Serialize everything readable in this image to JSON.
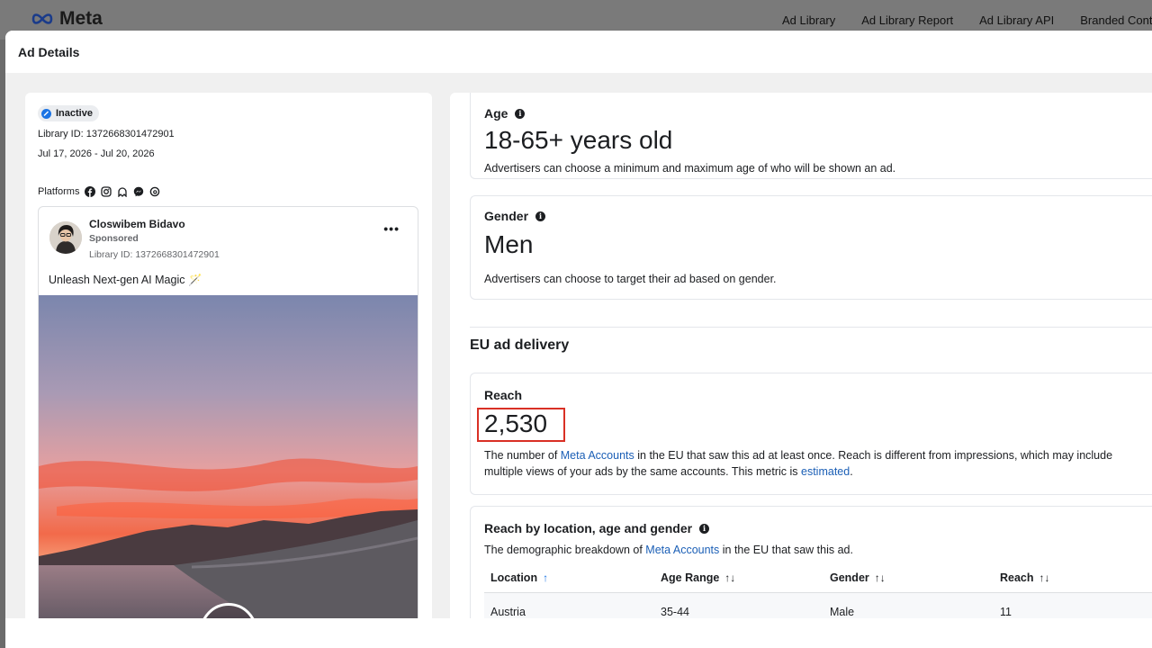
{
  "nav": {
    "brand": "Meta",
    "links": [
      "Ad Library",
      "Ad Library Report",
      "Ad Library API",
      "Branded Content"
    ]
  },
  "modal": {
    "title": "Ad Details"
  },
  "ad": {
    "status": "Inactive",
    "library_id_line": "Library ID: 1372668301472901",
    "dates": "Jul 17, 2026 - Jul 20, 2026",
    "platforms_label": "Platforms",
    "platform_icons": [
      "facebook-icon",
      "instagram-icon",
      "audience-network-icon",
      "messenger-icon",
      "threads-icon"
    ],
    "advertiser": "Closwibem Bidavo",
    "sponsored": "Sponsored",
    "preview_library_id": "Library ID: 1372668301472901",
    "text": "Unleash Next-gen AI Magic 🪄"
  },
  "age": {
    "title": "Age",
    "value": "18-65+ years old",
    "description": "Advertisers can choose a minimum and maximum age of who will be shown an ad."
  },
  "gender": {
    "title": "Gender",
    "value": "Men",
    "description": "Advertisers can choose to target their ad based on gender."
  },
  "eu": {
    "section_title": "EU ad delivery",
    "reach_title": "Reach",
    "reach_value": "2,530",
    "reach_desc_1": "The number of ",
    "reach_desc_link": "Meta Accounts",
    "reach_desc_2": " in the EU that saw this ad at least once. Reach is different from impressions, which may include multiple views of your ads by the same accounts. This metric is ",
    "reach_desc_link2": "estimated",
    "reach_desc_3": "."
  },
  "breakdown": {
    "title": "Reach by location, age and gender",
    "desc_1": "The demographic breakdown of ",
    "desc_link": "Meta Accounts",
    "desc_2": " in the EU that saw this ad.",
    "columns": [
      "Location",
      "Age Range",
      "Gender",
      "Reach"
    ],
    "rows": [
      [
        "Austria",
        "35-44",
        "Male",
        "11"
      ]
    ]
  },
  "colors": {
    "accent": "#1b74e4",
    "link": "#1b5fb6",
    "highlight": "#d93025"
  }
}
